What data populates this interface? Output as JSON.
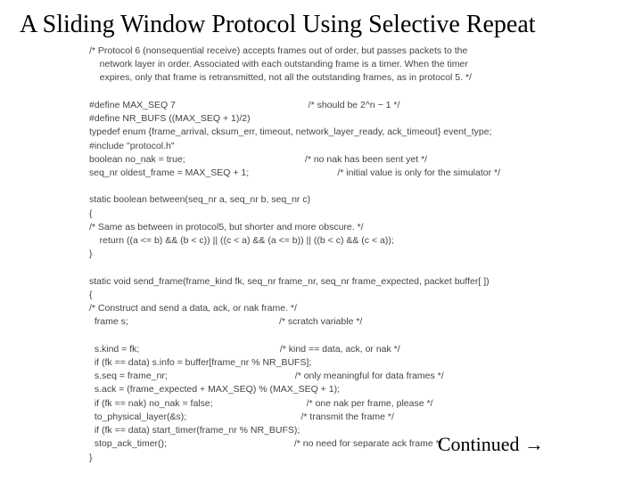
{
  "title": "A Sliding Window Protocol Using Selective Repeat",
  "code_lines": {
    "l0": "/* Protocol 6 (nonsequential receive) accepts frames out of order, but passes packets to the",
    "l1": "    network layer in order. Associated with each outstanding frame is a timer. When the timer",
    "l2": "    expires, only that frame is retransmitted, not all the outstanding frames, as in protocol 5. */",
    "l3": "",
    "l4": "#define MAX_SEQ 7                                                   /* should be 2^n − 1 */",
    "l5": "#define NR_BUFS ((MAX_SEQ + 1)/2)",
    "l6": "typedef enum {frame_arrival, cksum_err, timeout, network_layer_ready, ack_timeout} event_type;",
    "l7": "#include \"protocol.h\"",
    "l8": "boolean no_nak = true;                                              /* no nak has been sent yet */",
    "l9": "seq_nr oldest_frame = MAX_SEQ + 1;                                  /* initial value is only for the simulator */",
    "l10": "",
    "l11": "static boolean between(seq_nr a, seq_nr b, seq_nr c)",
    "l12": "{",
    "l13": "/* Same as between in protocol5, but shorter and more obscure. */",
    "l14": "    return ((a <= b) && (b < c)) || ((c < a) && (a <= b)) || ((b < c) && (c < a));",
    "l15": "}",
    "l16": "",
    "l17": "static void send_frame(frame_kind fk, seq_nr frame_nr, seq_nr frame_expected, packet buffer[ ])",
    "l18": "{",
    "l19": "/* Construct and send a data, ack, or nak frame. */",
    "l20": "  frame s;                                                          /* scratch variable */",
    "l21": "",
    "l22": "  s.kind = fk;                                                      /* kind == data, ack, or nak */",
    "l23": "  if (fk == data) s.info = buffer[frame_nr % NR_BUFS];",
    "l24": "  s.seq = frame_nr;                                                 /* only meaningful for data frames */",
    "l25": "  s.ack = (frame_expected + MAX_SEQ) % (MAX_SEQ + 1);",
    "l26": "  if (fk == nak) no_nak = false;                                    /* one nak per frame, please */",
    "l27": "  to_physical_layer(&s);                                            /* transmit the frame */",
    "l28": "  if (fk == data) start_timer(frame_nr % NR_BUFS);",
    "l29": "  stop_ack_timer();                                                 /* no need for separate ack frame */",
    "l30": "}"
  },
  "continued": "Continued →"
}
